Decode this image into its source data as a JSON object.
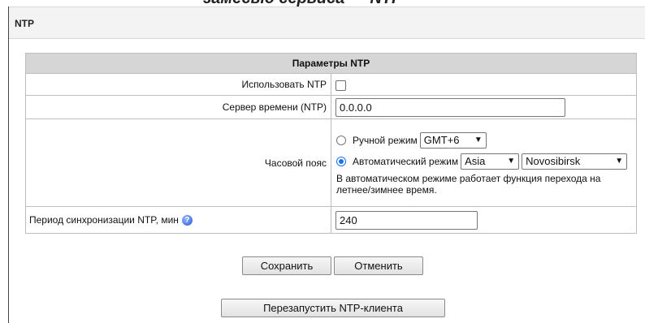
{
  "doc_header": "замесью сервиса — NTP",
  "panel": {
    "title": "NTP"
  },
  "table": {
    "header": "Параметры NTP"
  },
  "rows": {
    "use_ntp": {
      "label": "Использовать NTP",
      "checked": false
    },
    "server": {
      "label": "Сервер времени (NTP)",
      "value": "0.0.0.0"
    },
    "timezone": {
      "label": "Часовой пояс",
      "manual": {
        "label": "Ручной режим",
        "selected": "GMT+6",
        "checked": false
      },
      "auto": {
        "label": "Автоматический режим",
        "region": "Asia",
        "city": "Novosibirsk",
        "checked": true
      },
      "note": "В автоматическом режиме работает функция перехода на летнее/зимнее время."
    },
    "period": {
      "label": "Период синхронизации NTP, мин",
      "value": "240",
      "help_icon": "help-icon"
    }
  },
  "buttons": {
    "save": "Сохранить",
    "cancel": "Отменить",
    "restart": "Перезапустить NTP-клиента"
  }
}
